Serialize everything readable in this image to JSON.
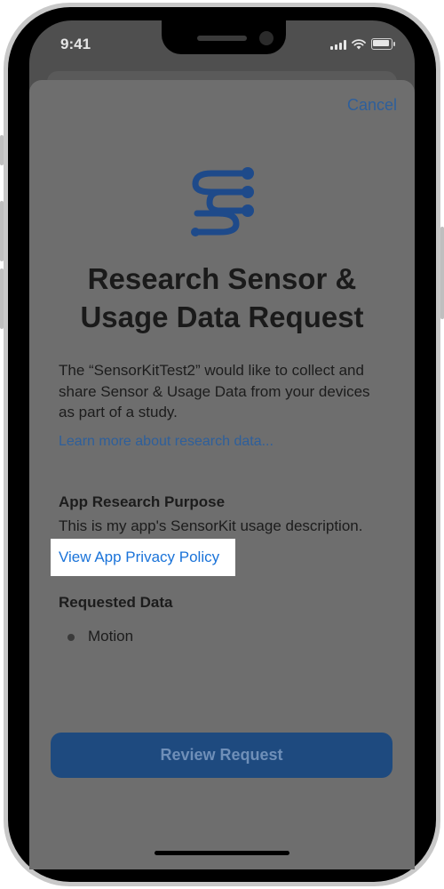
{
  "status_bar": {
    "time": "9:41"
  },
  "sheet": {
    "cancel_label": "Cancel",
    "title_line1": "Research Sensor &",
    "title_line2": "Usage Data Request",
    "description": "The “SensorKitTest2” would like to collect and share Sensor & Usage Data from your devices as part of a study.",
    "learn_more_link": "Learn more about research data...",
    "purpose_heading": "App Research Purpose",
    "purpose_text": "This is my app's SensorKit usage description.",
    "privacy_policy_link": "View App Privacy Policy",
    "requested_heading": "Requested Data",
    "requested_items": [
      "Motion"
    ],
    "review_button": "Review Request"
  },
  "icons": {
    "logo": "sensorkit-logo-icon",
    "wifi": "wifi-icon",
    "signal": "cellular-signal-icon",
    "battery": "battery-icon"
  },
  "colors": {
    "accent": "#1a73d9",
    "button_bg": "#1e4a7f",
    "logo": "#1e4a8a"
  }
}
